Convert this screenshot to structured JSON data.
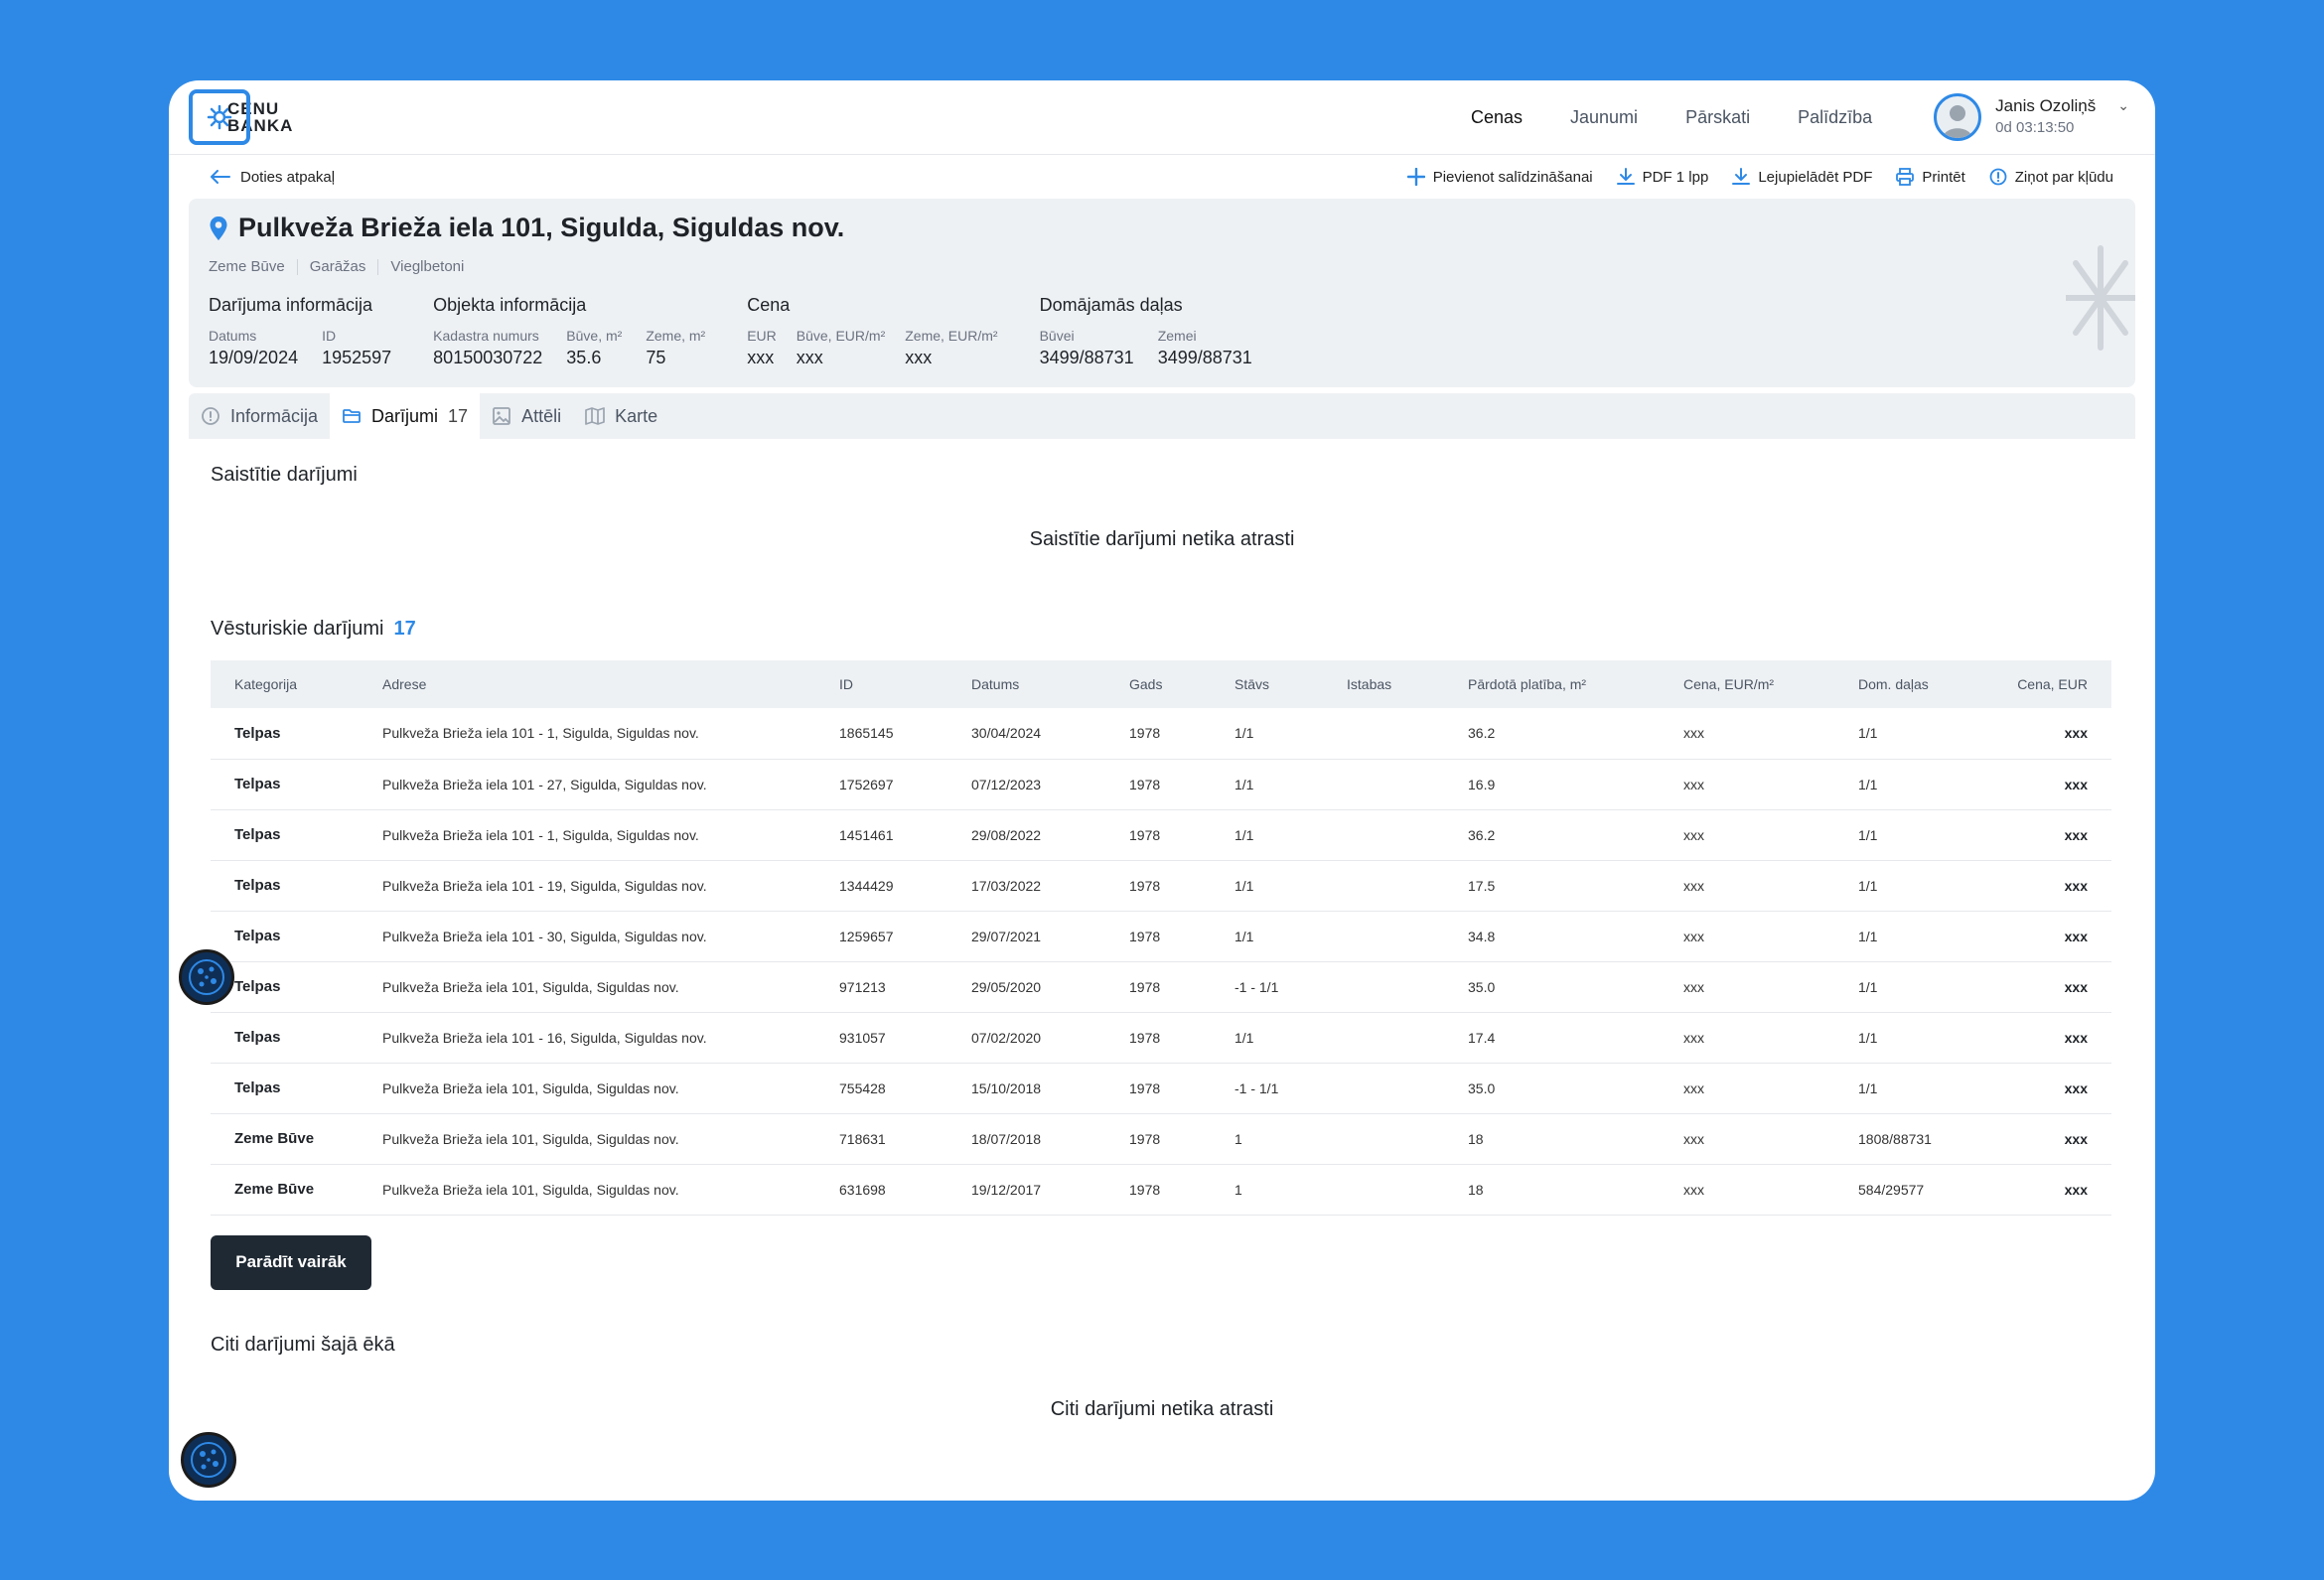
{
  "header": {
    "logo_line1": "CENU",
    "logo_line2": "BANKA",
    "nav": [
      "Cenas",
      "Jaunumi",
      "Pārskati",
      "Palīdzība"
    ],
    "user_name": "Janis Ozoliņš",
    "user_time": "0d 03:13:50"
  },
  "actionbar": {
    "back_label": "Doties atpakaļ",
    "actions": [
      "Pievienot salīdzināšanai",
      "PDF 1 lpp",
      "Lejupielādēt PDF",
      "Printēt",
      "Ziņot par kļūdu"
    ]
  },
  "summary": {
    "title": "Pulkveža Brieža iela 101, Sigulda, Siguldas nov.",
    "tags": [
      "Zeme Būve",
      "Garāžas",
      "Vieglbetoni"
    ],
    "groups": [
      {
        "heading": "Darījuma informācija",
        "cols": [
          {
            "label": "Datums",
            "value": "19/09/2024"
          },
          {
            "label": "ID",
            "value": "1952597"
          }
        ]
      },
      {
        "heading": "Objekta informācija",
        "cols": [
          {
            "label": "Kadastra numurs",
            "value": "80150030722"
          },
          {
            "label": "Būve, m²",
            "value": "35.6"
          },
          {
            "label": "Zeme, m²",
            "value": "75"
          }
        ]
      },
      {
        "heading": "Cena",
        "cols": [
          {
            "label": "EUR",
            "value": "xxx"
          },
          {
            "label": "Būve, EUR/m²",
            "value": "xxx"
          },
          {
            "label": "Zeme, EUR/m²",
            "value": "xxx"
          }
        ]
      },
      {
        "heading": "Domājamās daļas",
        "cols": [
          {
            "label": "Būvei",
            "value": "3499/88731"
          },
          {
            "label": "Zemei",
            "value": "3499/88731"
          }
        ]
      }
    ]
  },
  "tabs": [
    {
      "label": "Informācija",
      "count": ""
    },
    {
      "label": "Darījumi",
      "count": "17"
    },
    {
      "label": "Attēli",
      "count": ""
    },
    {
      "label": "Karte",
      "count": ""
    }
  ],
  "related": {
    "title": "Saistītie darījumi",
    "empty": "Saistītie darījumi netika atrasti"
  },
  "history": {
    "title": "Vēsturiskie darījumi",
    "count": "17",
    "columns": [
      "Kategorija",
      "Adrese",
      "ID",
      "Datums",
      "Gads",
      "Stāvs",
      "Istabas",
      "Pārdotā platība, m²",
      "Cena, EUR/m²",
      "Dom. daļas",
      "Cena, EUR"
    ],
    "rows": [
      [
        "Telpas",
        "Pulkveža Brieža iela 101 - 1, Sigulda, Siguldas nov.",
        "1865145",
        "30/04/2024",
        "1978",
        "1/1",
        "",
        "36.2",
        "xxx",
        "1/1",
        "xxx"
      ],
      [
        "Telpas",
        "Pulkveža Brieža iela 101 - 27, Sigulda, Siguldas nov.",
        "1752697",
        "07/12/2023",
        "1978",
        "1/1",
        "",
        "16.9",
        "xxx",
        "1/1",
        "xxx"
      ],
      [
        "Telpas",
        "Pulkveža Brieža iela 101 - 1, Sigulda, Siguldas nov.",
        "1451461",
        "29/08/2022",
        "1978",
        "1/1",
        "",
        "36.2",
        "xxx",
        "1/1",
        "xxx"
      ],
      [
        "Telpas",
        "Pulkveža Brieža iela 101 - 19, Sigulda, Siguldas nov.",
        "1344429",
        "17/03/2022",
        "1978",
        "1/1",
        "",
        "17.5",
        "xxx",
        "1/1",
        "xxx"
      ],
      [
        "Telpas",
        "Pulkveža Brieža iela 101 - 30, Sigulda, Siguldas nov.",
        "1259657",
        "29/07/2021",
        "1978",
        "1/1",
        "",
        "34.8",
        "xxx",
        "1/1",
        "xxx"
      ],
      [
        "Telpas",
        "Pulkveža Brieža iela 101, Sigulda, Siguldas nov.",
        "971213",
        "29/05/2020",
        "1978",
        "-1 - 1/1",
        "",
        "35.0",
        "xxx",
        "1/1",
        "xxx"
      ],
      [
        "Telpas",
        "Pulkveža Brieža iela 101 - 16, Sigulda, Siguldas nov.",
        "931057",
        "07/02/2020",
        "1978",
        "1/1",
        "",
        "17.4",
        "xxx",
        "1/1",
        "xxx"
      ],
      [
        "Telpas",
        "Pulkveža Brieža iela 101, Sigulda, Siguldas nov.",
        "755428",
        "15/10/2018",
        "1978",
        "-1 - 1/1",
        "",
        "35.0",
        "xxx",
        "1/1",
        "xxx"
      ],
      [
        "Zeme Būve",
        "Pulkveža Brieža iela 101, Sigulda, Siguldas nov.",
        "718631",
        "18/07/2018",
        "1978",
        "1",
        "",
        "18",
        "xxx",
        "1808/88731",
        "xxx"
      ],
      [
        "Zeme Būve",
        "Pulkveža Brieža iela 101, Sigulda, Siguldas nov.",
        "631698",
        "19/12/2017",
        "1978",
        "1",
        "",
        "18",
        "xxx",
        "584/29577",
        "xxx"
      ]
    ],
    "more_label": "Parādīt vairāk"
  },
  "other": {
    "title": "Citi darījumi šajā ēkā",
    "empty": "Citi darījumi netika atrasti"
  },
  "colors": {
    "accent": "#2E89E6",
    "dark_button": "#1f2933",
    "panel": "#eef1f4"
  }
}
